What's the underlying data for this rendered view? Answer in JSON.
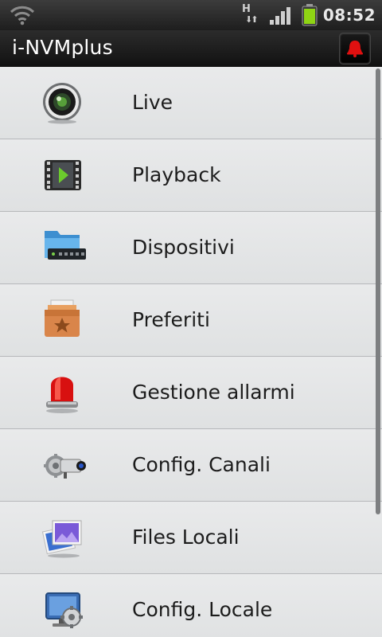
{
  "status_bar": {
    "network_type": "H",
    "time": "08:52",
    "icons": [
      "wifi-icon",
      "data-activity-icon",
      "signal-strength-icon",
      "battery-icon"
    ]
  },
  "title_bar": {
    "title": "i-NVMplus",
    "alarm_icon": "bell-icon"
  },
  "menu": {
    "items": [
      {
        "label": "Live",
        "icon": "camera-lens-icon"
      },
      {
        "label": "Playback",
        "icon": "film-play-icon"
      },
      {
        "label": "Dispositivi",
        "icon": "folder-dvr-icon"
      },
      {
        "label": "Preferiti",
        "icon": "star-box-icon"
      },
      {
        "label": "Gestione allarmi",
        "icon": "siren-light-icon"
      },
      {
        "label": "Config. Canali",
        "icon": "camera-gear-icon"
      },
      {
        "label": "Files Locali",
        "icon": "photos-icon"
      },
      {
        "label": "Config. Locale",
        "icon": "monitor-gear-icon"
      }
    ]
  },
  "colors": {
    "accent_alarm": "#e01010",
    "battery_green": "#8fd414",
    "list_bg": "#e3e5e6"
  }
}
